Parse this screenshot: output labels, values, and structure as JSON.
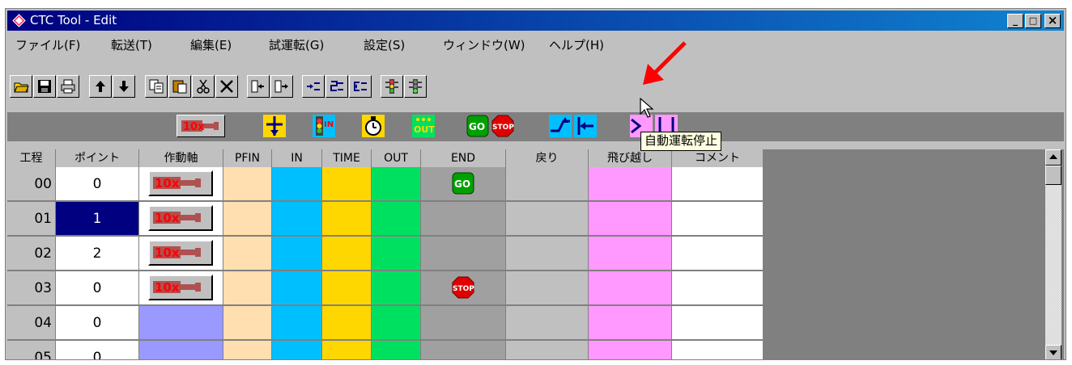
{
  "window": {
    "title": "CTC Tool - Edit",
    "minimize": "_",
    "maximize": "□",
    "close": "×"
  },
  "menu": [
    "ファイル(F)",
    "転送(T)",
    "編集(E)",
    "試運転(G)",
    "設定(S)",
    "ウィンドウ(W)",
    "ヘルプ(H)"
  ],
  "toolbar_icons": [
    "open-folder-icon",
    "save-icon",
    "print-icon",
    "move-up-icon",
    "move-down-icon",
    "copy-icon",
    "paste-icon",
    "cut-icon",
    "delete-icon",
    "insert-row-icon",
    "append-row-icon",
    "step-insert-icon",
    "step-jump-icon",
    "step-return-icon",
    "auto-run-start-icon",
    "auto-run-stop-icon"
  ],
  "gray_icons": [
    "actuator-icon",
    "axis-wait-icon",
    "in-signal-icon",
    "timer-icon",
    "out-signal-icon",
    "go-icon",
    "stop-icon",
    "jump-icon",
    "return-icon",
    "skip-icon",
    "end-icon"
  ],
  "tooltip": "自動運転停止",
  "columns": [
    "工程",
    "ポイント",
    "作動軸",
    "PFIN",
    "IN",
    "TIME",
    "OUT",
    "END",
    "戻り",
    "飛び越し",
    "コメント"
  ],
  "rows": [
    {
      "step": "00",
      "point": "0",
      "axis": true,
      "end": "GO"
    },
    {
      "step": "01",
      "point": "1",
      "axis": true,
      "end": "",
      "selected": true
    },
    {
      "step": "02",
      "point": "2",
      "axis": true,
      "end": ""
    },
    {
      "step": "03",
      "point": "0",
      "axis": true,
      "end": "STOP"
    },
    {
      "step": "04",
      "point": "0",
      "axis": false,
      "end": ""
    },
    {
      "step": "05",
      "point": "0",
      "axis": false,
      "end": ""
    }
  ],
  "badges": {
    "go": "GO",
    "stop": "STOP",
    "in": "IN",
    "out": "OUT",
    "actuator": "10x"
  },
  "colors": {
    "pfin": "#ffdeb0",
    "in": "#00bfff",
    "time": "#ffd700",
    "out": "#00e060",
    "end": "#a0a0a0",
    "ret": "#c0c0c0",
    "skip": "#ff99ff",
    "axis_empty": "#9999ff",
    "annotation": "#ff0000"
  }
}
